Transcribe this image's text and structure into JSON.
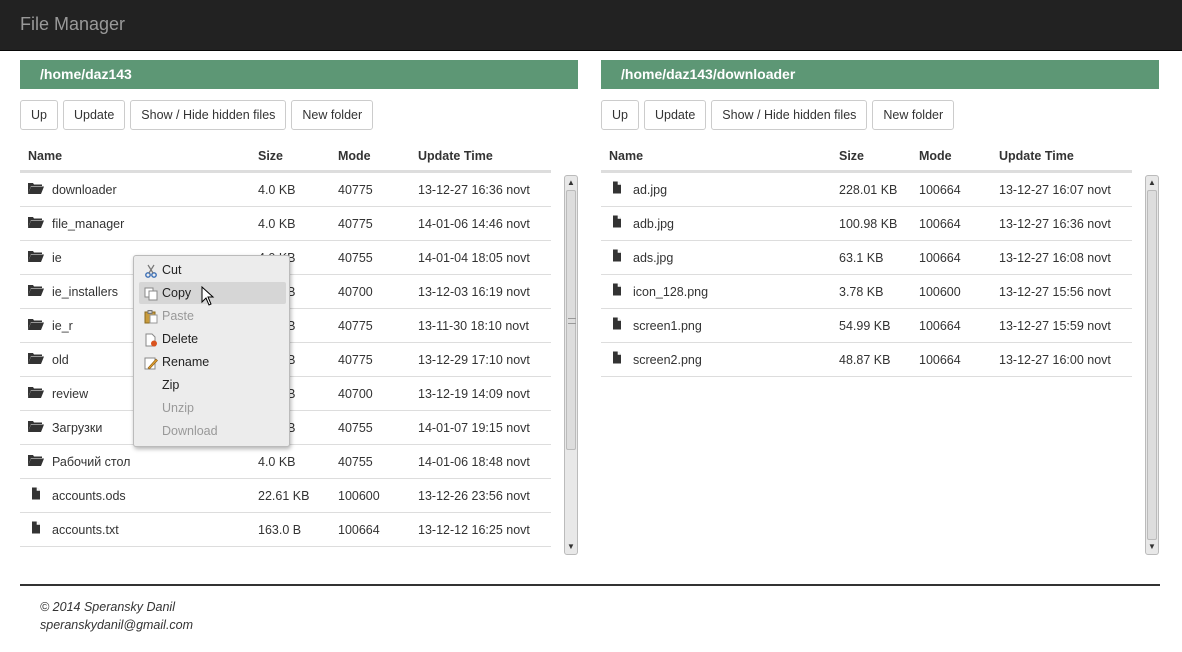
{
  "app": {
    "title": "File Manager"
  },
  "left": {
    "path": "/home/daz143",
    "buttons": {
      "up": "Up",
      "update": "Update",
      "hidden": "Show / Hide hidden files",
      "new_folder": "New folder"
    },
    "headers": {
      "name": "Name",
      "size": "Size",
      "mode": "Mode",
      "time": "Update Time"
    },
    "rows": [
      {
        "name": "downloader",
        "size": "4.0 KB",
        "mode": "40775",
        "time": "13-12-27 16:36 novt",
        "type": "folder"
      },
      {
        "name": "file_manager",
        "size": "4.0 KB",
        "mode": "40775",
        "time": "14-01-06 14:46 novt",
        "type": "folder"
      },
      {
        "name": "ie",
        "size": "4.0 KB",
        "mode": "40755",
        "time": "14-01-04 18:05 novt",
        "type": "folder"
      },
      {
        "name": "ie_installers",
        "size": "4.0 KB",
        "mode": "40700",
        "time": "13-12-03 16:19 novt",
        "type": "folder"
      },
      {
        "name": "ie_r",
        "size": "4.0 KB",
        "mode": "40775",
        "time": "13-11-30 18:10 novt",
        "type": "folder"
      },
      {
        "name": "old",
        "size": "4.0 KB",
        "mode": "40775",
        "time": "13-12-29 17:10 novt",
        "type": "folder"
      },
      {
        "name": "review",
        "size": "4.0 KB",
        "mode": "40700",
        "time": "13-12-19 14:09 novt",
        "type": "folder"
      },
      {
        "name": "Загрузки",
        "size": "4.0 KB",
        "mode": "40755",
        "time": "14-01-07 19:15 novt",
        "type": "folder"
      },
      {
        "name": "Рабочий стол",
        "size": "4.0 KB",
        "mode": "40755",
        "time": "14-01-06 18:48 novt",
        "type": "folder"
      },
      {
        "name": "accounts.ods",
        "size": "22.61 KB",
        "mode": "100600",
        "time": "13-12-26 23:56 novt",
        "type": "file"
      },
      {
        "name": "accounts.txt",
        "size": "163.0 B",
        "mode": "100664",
        "time": "13-12-12 16:25 novt",
        "type": "file"
      }
    ]
  },
  "right": {
    "path": "/home/daz143/downloader",
    "buttons": {
      "up": "Up",
      "update": "Update",
      "hidden": "Show / Hide hidden files",
      "new_folder": "New folder"
    },
    "headers": {
      "name": "Name",
      "size": "Size",
      "mode": "Mode",
      "time": "Update Time"
    },
    "rows": [
      {
        "name": "ad.jpg",
        "size": "228.01 KB",
        "mode": "100664",
        "time": "13-12-27 16:07 novt",
        "type": "file"
      },
      {
        "name": "adb.jpg",
        "size": "100.98 KB",
        "mode": "100664",
        "time": "13-12-27 16:36 novt",
        "type": "file"
      },
      {
        "name": "ads.jpg",
        "size": "63.1 KB",
        "mode": "100664",
        "time": "13-12-27 16:08 novt",
        "type": "file"
      },
      {
        "name": "icon_128.png",
        "size": "3.78 KB",
        "mode": "100600",
        "time": "13-12-27 15:56 novt",
        "type": "file"
      },
      {
        "name": "screen1.png",
        "size": "54.99 KB",
        "mode": "100664",
        "time": "13-12-27 15:59 novt",
        "type": "file"
      },
      {
        "name": "screen2.png",
        "size": "48.87 KB",
        "mode": "100664",
        "time": "13-12-27 16:00 novt",
        "type": "file"
      }
    ]
  },
  "context_menu": {
    "items": [
      {
        "label": "Cut",
        "icon": "scissors-icon",
        "disabled": false
      },
      {
        "label": "Copy",
        "icon": "copy-icon",
        "disabled": false,
        "hover": true
      },
      {
        "label": "Paste",
        "icon": "paste-icon",
        "disabled": true
      },
      {
        "label": "Delete",
        "icon": "delete-icon",
        "disabled": false
      },
      {
        "label": "Rename",
        "icon": "rename-icon",
        "disabled": false
      },
      {
        "label": "Zip",
        "icon": "",
        "disabled": false
      },
      {
        "label": "Unzip",
        "icon": "",
        "disabled": true
      },
      {
        "label": "Download",
        "icon": "",
        "disabled": true
      }
    ]
  },
  "footer": {
    "copyright": "© 2014 Speransky Danil",
    "email": "speranskydanil@gmail.com"
  },
  "colors": {
    "navbar": "#222222",
    "path_bar": "#5d9775"
  }
}
